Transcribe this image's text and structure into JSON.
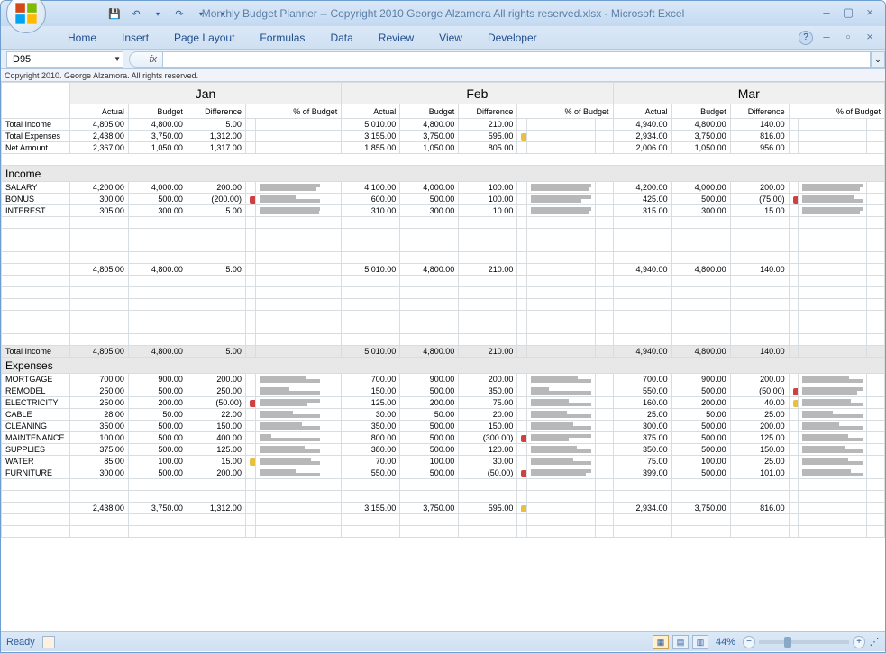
{
  "window": {
    "title": "Monthly Budget Planner -- Copyright 2010 George Alzamora  All rights reserved.xlsx - Microsoft Excel",
    "copyright": "Copyright 2010.  George Alzamora.  All rights reserved."
  },
  "ribbon": {
    "tabs": [
      "Home",
      "Insert",
      "Page Layout",
      "Formulas",
      "Data",
      "Review",
      "View",
      "Developer"
    ]
  },
  "formula_bar": {
    "name_box": "D95",
    "formula": ""
  },
  "sheet": {
    "months": [
      "Jan",
      "Feb",
      "Mar"
    ],
    "col_headers": [
      "Actual",
      "Budget",
      "Difference",
      "% of Budget"
    ],
    "summary_rows": [
      {
        "label": "Total Income",
        "data": [
          [
            "4,805.00",
            "4,800.00",
            "5.00",
            ""
          ],
          [
            "5,010.00",
            "4,800.00",
            "210.00",
            ""
          ],
          [
            "4,940.00",
            "4,800.00",
            "140.00",
            ""
          ]
        ]
      },
      {
        "label": "Total Expenses",
        "data": [
          [
            "2,438.00",
            "3,750.00",
            "1,312.00",
            ""
          ],
          [
            "3,155.00",
            "3,750.00",
            "595.00",
            "yellow"
          ],
          [
            "2,934.00",
            "3,750.00",
            "816.00",
            ""
          ]
        ]
      },
      {
        "label": "Net Amount",
        "data": [
          [
            "2,367.00",
            "1,050.00",
            "1,317.00",
            ""
          ],
          [
            "1,855.00",
            "1,050.00",
            "805.00",
            ""
          ],
          [
            "2,006.00",
            "1,050.00",
            "956.00",
            ""
          ]
        ]
      }
    ],
    "income_header": "Income",
    "income_rows": [
      {
        "label": "SALARY",
        "data": [
          [
            "4,200.00",
            "4,000.00",
            "200.00",
            "",
            true
          ],
          [
            "4,100.00",
            "4,000.00",
            "100.00",
            "",
            true
          ],
          [
            "4,200.00",
            "4,000.00",
            "200.00",
            "",
            true
          ]
        ]
      },
      {
        "label": "BONUS",
        "data": [
          [
            "300.00",
            "500.00",
            "(200.00)",
            "red",
            true
          ],
          [
            "600.00",
            "500.00",
            "100.00",
            "",
            true
          ],
          [
            "425.00",
            "500.00",
            "(75.00)",
            "red",
            true
          ]
        ]
      },
      {
        "label": "INTEREST",
        "data": [
          [
            "305.00",
            "300.00",
            "5.00",
            "",
            true
          ],
          [
            "310.00",
            "300.00",
            "10.00",
            "",
            true
          ],
          [
            "315.00",
            "300.00",
            "15.00",
            "",
            true
          ]
        ]
      }
    ],
    "income_subtotal": [
      [
        "4,805.00",
        "4,800.00",
        "5.00"
      ],
      [
        "5,010.00",
        "4,800.00",
        "210.00"
      ],
      [
        "4,940.00",
        "4,800.00",
        "140.00"
      ]
    ],
    "total_income_label": "Total Income",
    "total_income": [
      [
        "4,805.00",
        "4,800.00",
        "5.00"
      ],
      [
        "5,010.00",
        "4,800.00",
        "210.00"
      ],
      [
        "4,940.00",
        "4,800.00",
        "140.00"
      ]
    ],
    "expenses_header": "Expenses",
    "expense_rows": [
      {
        "label": "MORTGAGE",
        "data": [
          [
            "700.00",
            "900.00",
            "200.00",
            "",
            true
          ],
          [
            "700.00",
            "900.00",
            "200.00",
            "",
            true
          ],
          [
            "700.00",
            "900.00",
            "200.00",
            "",
            true
          ]
        ]
      },
      {
        "label": "REMODEL",
        "data": [
          [
            "250.00",
            "500.00",
            "250.00",
            "",
            true
          ],
          [
            "150.00",
            "500.00",
            "350.00",
            "",
            true
          ],
          [
            "550.00",
            "500.00",
            "(50.00)",
            "red",
            true
          ]
        ]
      },
      {
        "label": "ELECTRICITY",
        "data": [
          [
            "250.00",
            "200.00",
            "(50.00)",
            "red",
            true
          ],
          [
            "125.00",
            "200.00",
            "75.00",
            "",
            true
          ],
          [
            "160.00",
            "200.00",
            "40.00",
            "yellow",
            true
          ]
        ]
      },
      {
        "label": "CABLE",
        "data": [
          [
            "28.00",
            "50.00",
            "22.00",
            "",
            true
          ],
          [
            "30.00",
            "50.00",
            "20.00",
            "",
            true
          ],
          [
            "25.00",
            "50.00",
            "25.00",
            "",
            true
          ]
        ]
      },
      {
        "label": "CLEANING",
        "data": [
          [
            "350.00",
            "500.00",
            "150.00",
            "",
            true
          ],
          [
            "350.00",
            "500.00",
            "150.00",
            "",
            true
          ],
          [
            "300.00",
            "500.00",
            "200.00",
            "",
            true
          ]
        ]
      },
      {
        "label": "MAINTENANCE",
        "data": [
          [
            "100.00",
            "500.00",
            "400.00",
            "",
            true
          ],
          [
            "800.00",
            "500.00",
            "(300.00)",
            "red",
            true
          ],
          [
            "375.00",
            "500.00",
            "125.00",
            "",
            true
          ]
        ]
      },
      {
        "label": "SUPPLIES",
        "data": [
          [
            "375.00",
            "500.00",
            "125.00",
            "",
            true
          ],
          [
            "380.00",
            "500.00",
            "120.00",
            "",
            true
          ],
          [
            "350.00",
            "500.00",
            "150.00",
            "",
            true
          ]
        ]
      },
      {
        "label": "WATER",
        "data": [
          [
            "85.00",
            "100.00",
            "15.00",
            "yellow",
            true
          ],
          [
            "70.00",
            "100.00",
            "30.00",
            "",
            true
          ],
          [
            "75.00",
            "100.00",
            "25.00",
            "",
            true
          ]
        ]
      },
      {
        "label": "FURNITURE",
        "data": [
          [
            "300.00",
            "500.00",
            "200.00",
            "",
            true
          ],
          [
            "550.00",
            "500.00",
            "(50.00)",
            "red",
            true
          ],
          [
            "399.00",
            "500.00",
            "101.00",
            "",
            true
          ]
        ]
      }
    ],
    "expense_subtotal": [
      [
        "2,438.00",
        "3,750.00",
        "1,312.00",
        ""
      ],
      [
        "3,155.00",
        "3,750.00",
        "595.00",
        "yellow"
      ],
      [
        "2,934.00",
        "3,750.00",
        "816.00",
        ""
      ]
    ]
  },
  "statusbar": {
    "ready": "Ready",
    "zoom": "44%"
  }
}
